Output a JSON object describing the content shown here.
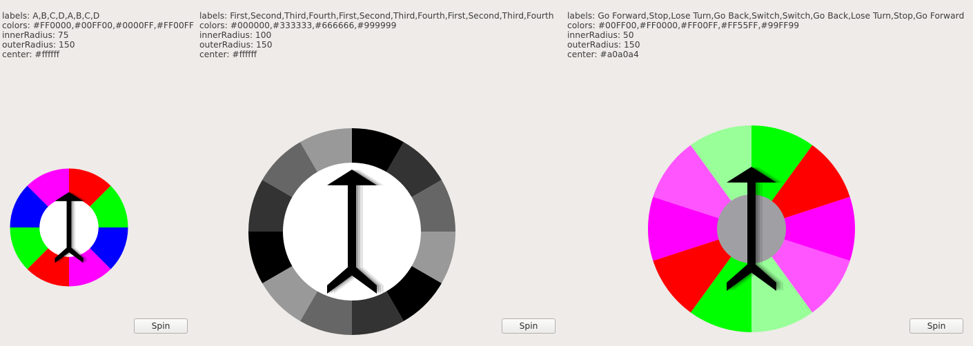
{
  "wheels": [
    {
      "labels_caption": "labels: A,B,C,D,A,B,C,D",
      "colors_caption": "colors: #FF0000,#00FF00,#0000FF,#FF00FF",
      "inner_caption": "innerRadius: 75",
      "outer_caption": "outerRadius: 150",
      "center_caption": "center: #ffffff",
      "labels": [
        "A",
        "B",
        "C",
        "D",
        "A",
        "B",
        "C",
        "D"
      ],
      "colors": [
        "#FF0000",
        "#00FF00",
        "#0000FF",
        "#FF00FF"
      ],
      "innerRadius": 75,
      "outerRadius": 150,
      "center": "#ffffff",
      "spin_label": "Spin"
    },
    {
      "labels_caption": "labels: First,Second,Third,Fourth,First,Second,Third,Fourth,First,Second,Third,Fourth",
      "colors_caption": "colors: #000000,#333333,#666666,#999999",
      "inner_caption": "innerRadius: 100",
      "outer_caption": "outerRadius: 150",
      "center_caption": "center: #ffffff",
      "labels": [
        "First",
        "Second",
        "Third",
        "Fourth",
        "First",
        "Second",
        "Third",
        "Fourth",
        "First",
        "Second",
        "Third",
        "Fourth"
      ],
      "colors": [
        "#000000",
        "#333333",
        "#666666",
        "#999999"
      ],
      "innerRadius": 100,
      "outerRadius": 150,
      "center": "#ffffff",
      "spin_label": "Spin"
    },
    {
      "labels_caption": "labels: Go Forward,Stop,Lose Turn,Go Back,Switch,Switch,Go Back,Lose Turn,Stop,Go Forward",
      "colors_caption": "colors: #00FF00,#FF0000,#FF00FF,#FF55FF,#99FF99",
      "inner_caption": "innerRadius: 50",
      "outer_caption": "outerRadius: 150",
      "center_caption": "center: #a0a0a4",
      "labels": [
        "Go Forward",
        "Stop",
        "Lose Turn",
        "Go Back",
        "Switch",
        "Switch",
        "Go Back",
        "Lose Turn",
        "Stop",
        "Go Forward"
      ],
      "colors": [
        "#00FF00",
        "#FF0000",
        "#FF00FF",
        "#FF55FF",
        "#99FF99"
      ],
      "innerRadius": 50,
      "outerRadius": 150,
      "center": "#a0a0a4",
      "spin_label": "Spin"
    }
  ],
  "icons": {
    "pointer": "arrow-pointer-icon"
  }
}
